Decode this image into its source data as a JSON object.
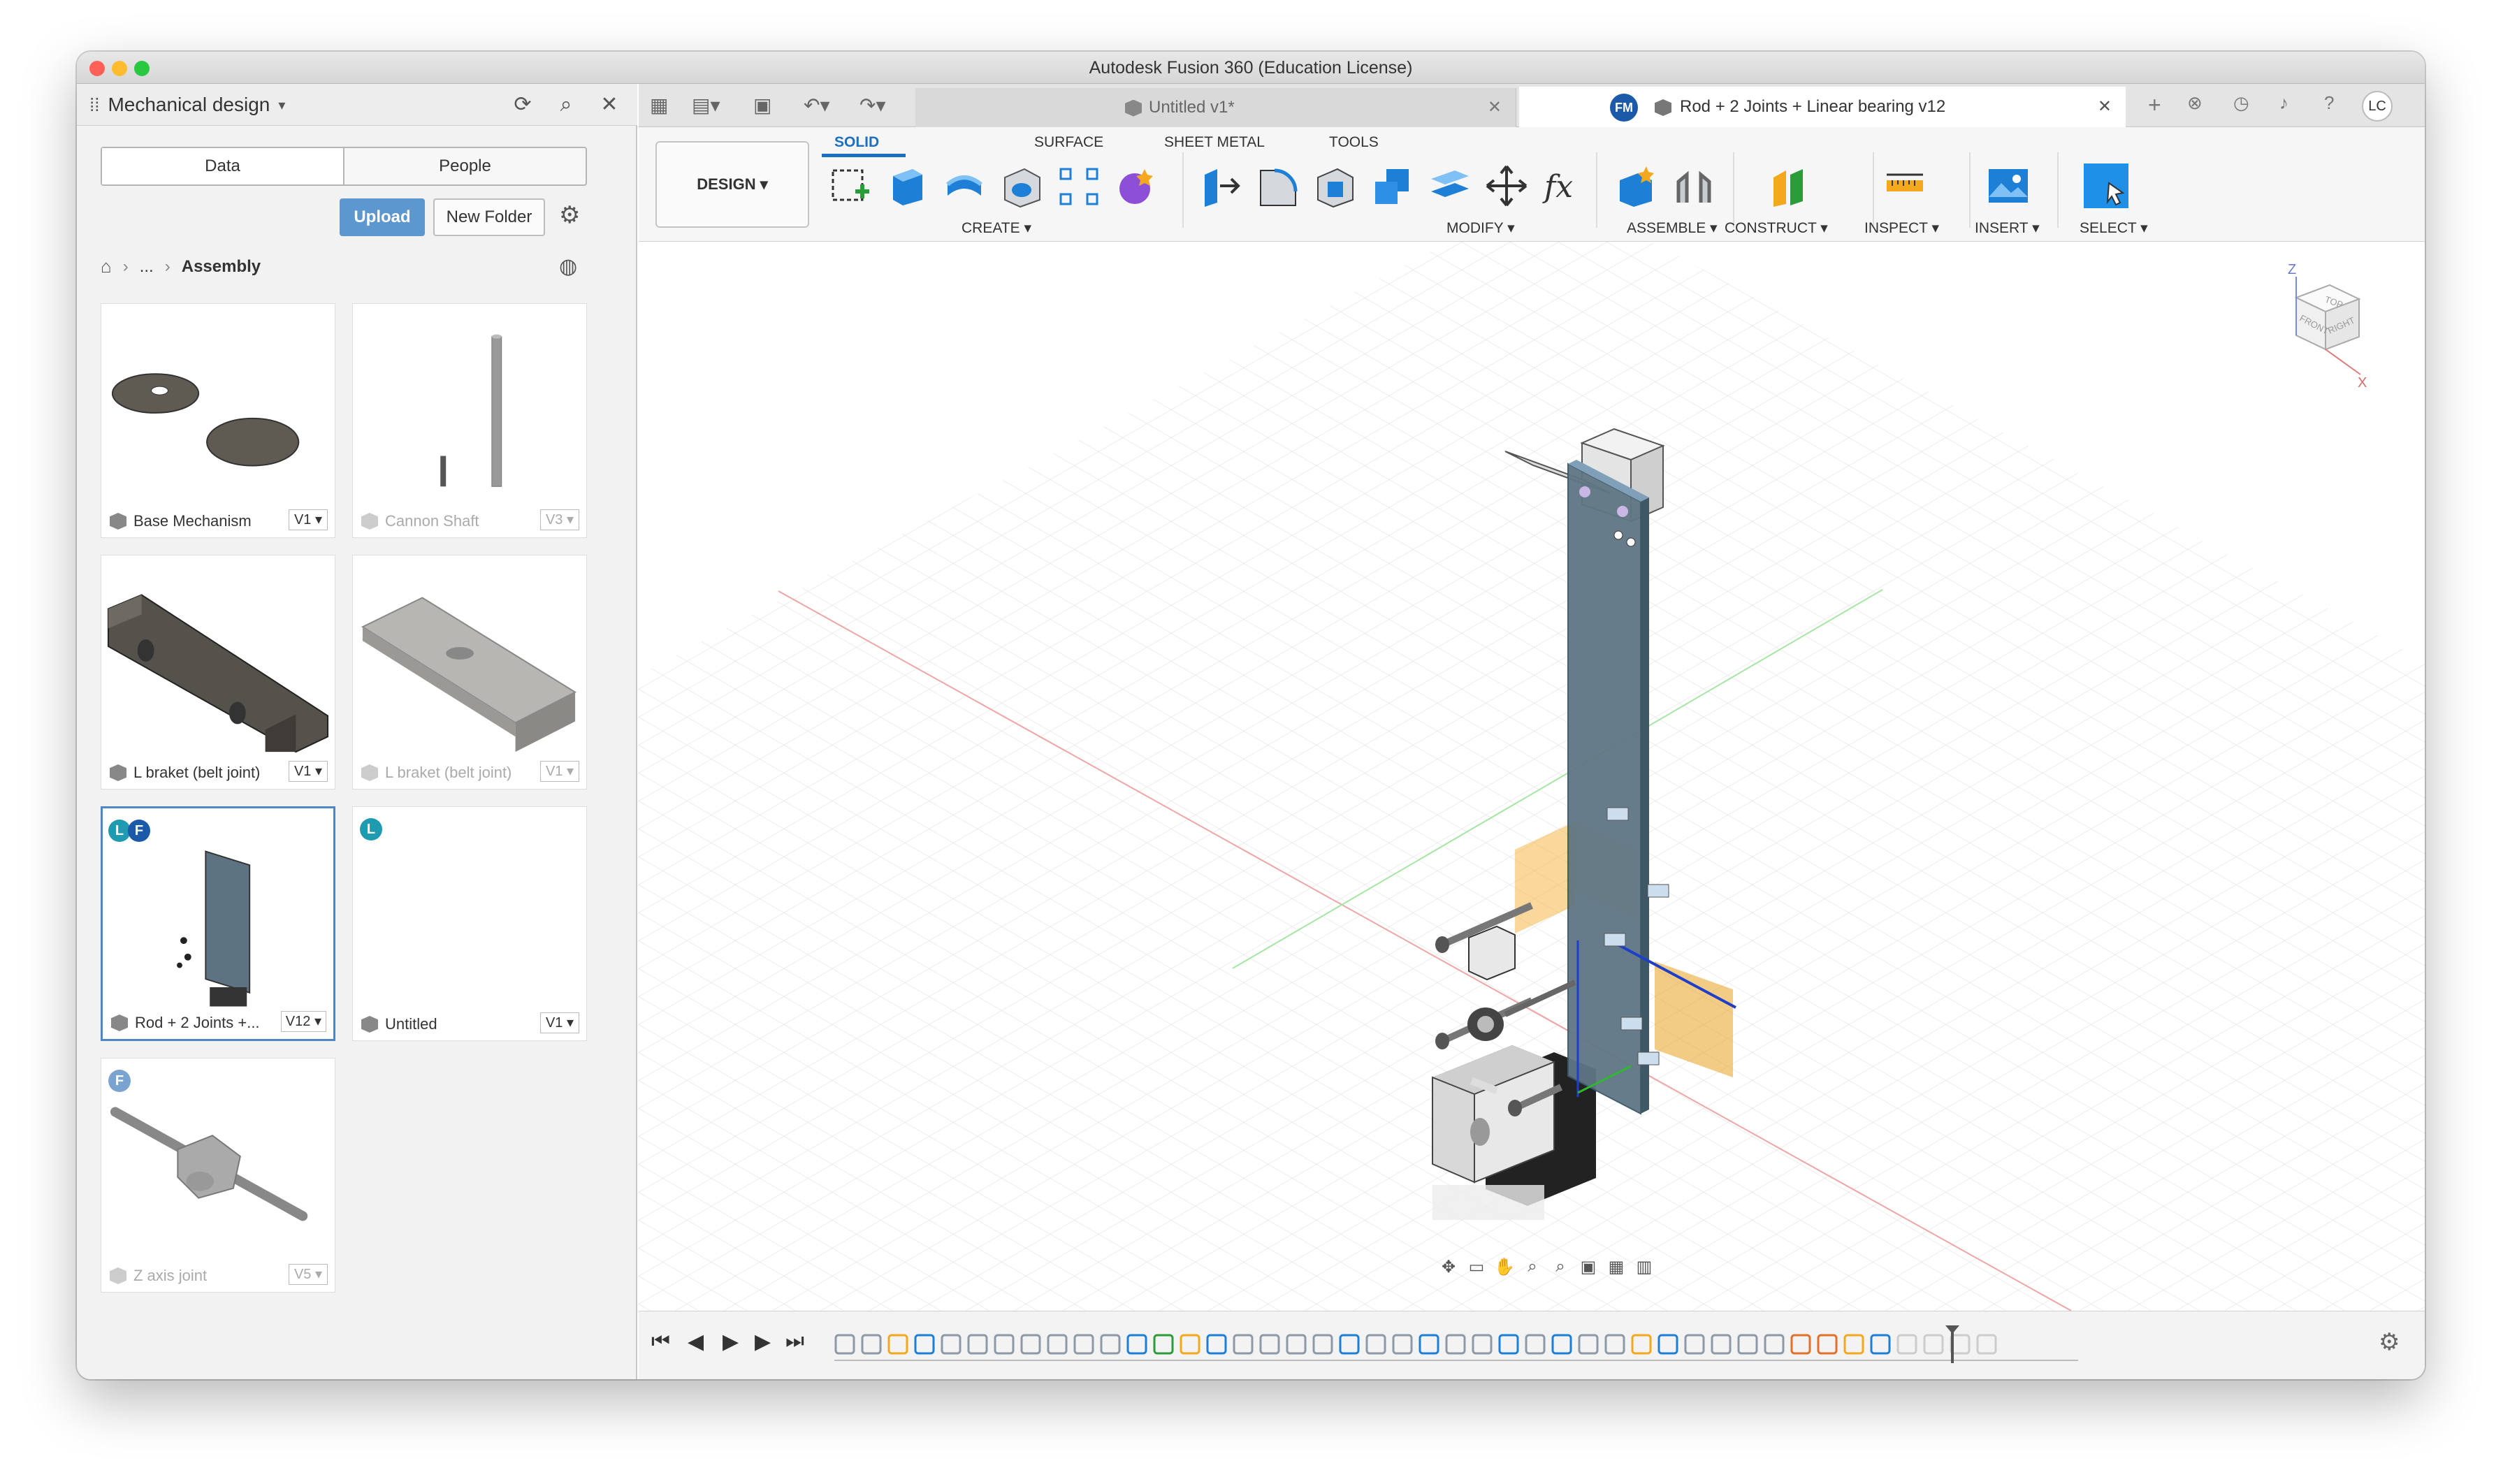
{
  "window": {
    "title": "Autodesk Fusion 360 (Education License)"
  },
  "data_panel": {
    "project_name": "Mechanical design",
    "tabs": [
      "Data",
      "People"
    ],
    "upload_label": "Upload",
    "new_folder_label": "New Folder",
    "breadcrumb": {
      "ellipsis": "...",
      "current": "Assembly"
    },
    "files": [
      {
        "name": "Base Mechanism",
        "version": "V1"
      },
      {
        "name": "Cannon Shaft",
        "version": "V3"
      },
      {
        "name": "L braket (belt joint)",
        "version": "V1"
      },
      {
        "name": "L braket (belt joint)",
        "version": "V1"
      },
      {
        "name": "Rod + 2 Joints +...",
        "version": "V12",
        "badges": [
          "L",
          "F"
        ]
      },
      {
        "name": "Untitled",
        "version": "V1",
        "badges": [
          "L"
        ]
      },
      {
        "name": "Z axis joint",
        "version": "V5",
        "badges": [
          "F"
        ]
      }
    ]
  },
  "tabs": {
    "tab1_title": "Untitled v1*",
    "tab2_title": "Rod + 2 Joints + Linear bearing v12",
    "tab2_avatar": "FM",
    "user_initials": "LC"
  },
  "toolbar": {
    "workspace": "DESIGN",
    "ribbon_tabs": [
      "SOLID",
      "SURFACE",
      "SHEET METAL",
      "TOOLS"
    ],
    "groups": [
      "CREATE",
      "MODIFY",
      "ASSEMBLE",
      "CONSTRUCT",
      "INSPECT",
      "INSERT",
      "SELECT"
    ]
  },
  "viewcube": {
    "faces": [
      "TOP",
      "FRONT",
      "RIGHT"
    ],
    "axes": [
      "Z",
      "X"
    ]
  },
  "icons": [
    "grid-icon",
    "file-icon",
    "save-icon",
    "undo-icon",
    "redo-icon",
    "refresh-icon",
    "search-icon",
    "close-icon",
    "gear-icon",
    "home-icon",
    "globe-icon",
    "bell-icon",
    "help-icon",
    "clock-icon",
    "extension-icon"
  ],
  "colors": {
    "accent": "#1e6fbf",
    "upload": "#5d97cf",
    "badge_l": "#1e9bb0",
    "badge_f": "#1a5aa8"
  }
}
